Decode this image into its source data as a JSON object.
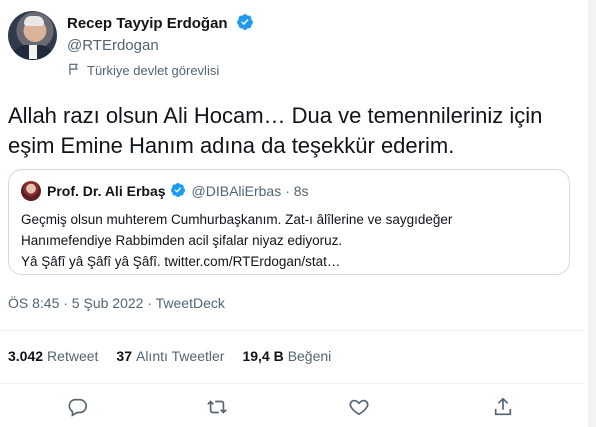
{
  "author": {
    "name": "Recep Tayyip Erdoğan",
    "handle": "@RTErdogan",
    "affiliation": "Türkiye devlet görevlisi",
    "verified": true
  },
  "tweet": {
    "text": "Allah razı olsun Ali Hocam… Dua ve temennileriniz için eşim Emine Hanım adına da teşekkür ederim."
  },
  "quote": {
    "name": "Prof. Dr. Ali Erbaş",
    "handle": "@DIBAliErbas",
    "time": "· 8s",
    "line1": "Geçmiş olsun muhterem Cumhurbaşkanım. Zat-ı âlîlerine ve saygıdeğer",
    "line2": "Hanımefendiye Rabbimden acil şifalar niyaz ediyoruz.",
    "line3": "Yâ Şâfî yâ Şâfî yâ Şâfî. twitter.com/RTErdogan/stat…"
  },
  "meta": {
    "text": "ÖS 8:45 · 5 Şub 2022 · TweetDeck"
  },
  "stats": {
    "retweets_count": "3.042",
    "retweets_label": "Retweet",
    "quotes_count": "37",
    "quotes_label": "Alıntı Tweetler",
    "likes_count": "19,4 B",
    "likes_label": "Beğeni"
  },
  "icons": {
    "reply": "comment-icon",
    "retweet": "retweet-icon",
    "like": "heart-icon",
    "share": "share-icon",
    "verified": "verified-badge-icon",
    "affiliation": "flag-icon"
  },
  "colors": {
    "verified": "#1d9bf0",
    "secondary_text": "#536471",
    "border": "#cfd9de"
  }
}
